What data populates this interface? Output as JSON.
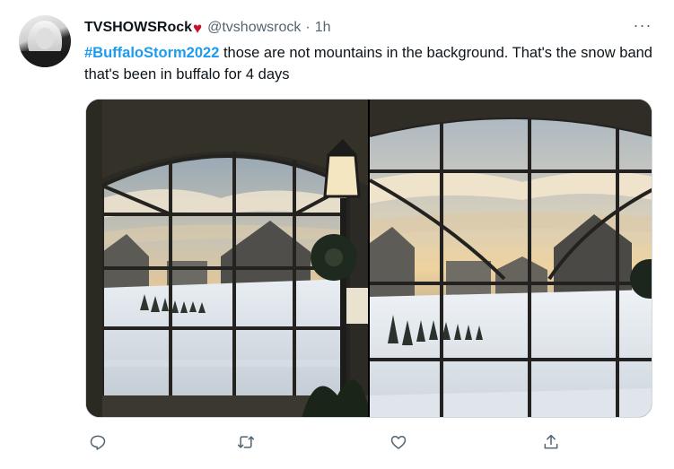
{
  "tweet": {
    "author_name": "TVSHOWSRock",
    "author_emoji": "♥",
    "handle": "@tvshowsrock",
    "separator": "·",
    "time": "1h",
    "more": "···",
    "hashtag": "#BuffaloStorm2022",
    "text": " those are not mountains in the background. That's the snow band that's been in buffalo for 4 days"
  },
  "actions": [
    {
      "name": "reply",
      "icon": "reply-icon"
    },
    {
      "name": "retweet",
      "icon": "retweet-icon"
    },
    {
      "name": "like",
      "icon": "heart-icon"
    },
    {
      "name": "share",
      "icon": "share-icon"
    }
  ],
  "colors": {
    "link": "#1d9bf0",
    "secondary_text": "#536471",
    "heart": "#c4122f"
  }
}
